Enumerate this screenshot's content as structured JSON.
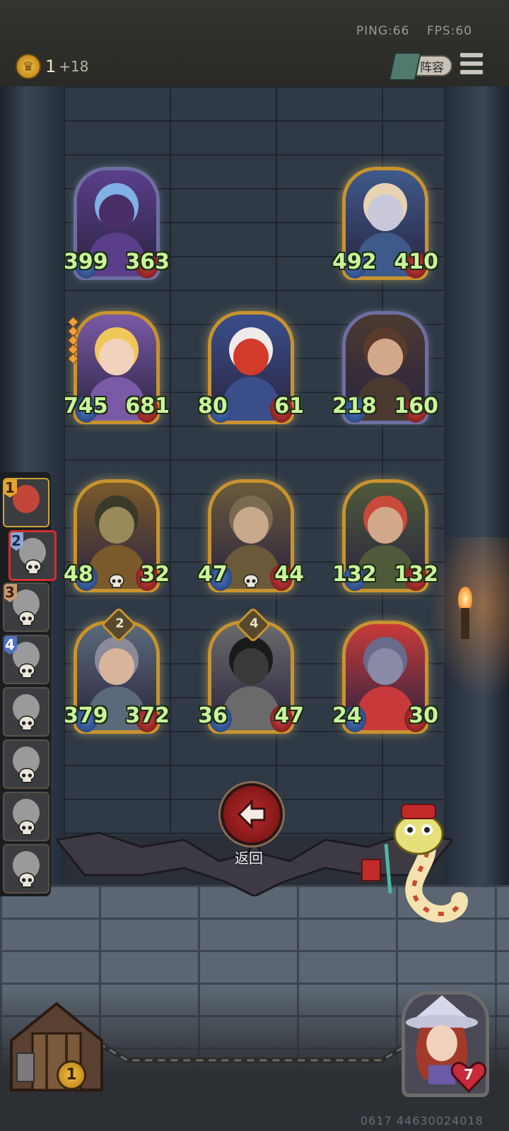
{
  "status_bar": {
    "ping": "PING:66",
    "fps": "FPS:60"
  },
  "currency": {
    "coins": "1",
    "income": "+18",
    "icon": "crown-coin-icon"
  },
  "toolbar": {
    "lineup_label": "阵容",
    "menu_icon": "hamburger-menu-icon"
  },
  "board": {
    "rows": [
      [
        {
          "name": "hero-blue-haired-mage",
          "atk": "399",
          "hp": "363",
          "frame": "silver",
          "pips": 0
        },
        null,
        {
          "name": "hero-bearded-king",
          "atk": "492",
          "hp": "410",
          "frame": "gold",
          "pips": 0
        }
      ],
      [
        {
          "name": "hero-blonde-boy",
          "atk": "745",
          "hp": "681",
          "frame": "gold",
          "pips": 5
        },
        {
          "name": "hero-clown",
          "atk": "80",
          "hp": "61",
          "frame": "gold",
          "pips": 0
        },
        {
          "name": "hero-mohawk-warrior",
          "atk": "218",
          "hp": "160",
          "frame": "silver",
          "pips": 0
        }
      ],
      [
        {
          "name": "hero-horned-goblin-lord",
          "atk": "48",
          "hp": "32",
          "frame": "gold",
          "skull": true
        },
        {
          "name": "hero-winged-beast",
          "atk": "47",
          "hp": "44",
          "frame": "gold",
          "skull": true
        },
        {
          "name": "hero-red-haired-ogre",
          "atk": "132",
          "hp": "132",
          "frame": "gold"
        }
      ],
      [
        {
          "name": "hero-armored-soldier",
          "atk": "379",
          "hp": "372",
          "frame": "gold",
          "tier": "2"
        },
        {
          "name": "hero-shield-knight",
          "atk": "36",
          "hp": "47",
          "frame": "gold",
          "tier": "4"
        },
        {
          "name": "hero-wolf-rogue",
          "atk": "24",
          "hp": "30",
          "frame": "gold"
        }
      ]
    ]
  },
  "opponents": [
    {
      "rank": "1",
      "state": "me"
    },
    {
      "rank": "2",
      "state": "current"
    },
    {
      "rank": "3",
      "state": "eliminated"
    },
    {
      "rank": "4",
      "state": "eliminated"
    },
    {
      "rank": "",
      "state": "eliminated"
    },
    {
      "rank": "",
      "state": "eliminated"
    },
    {
      "rank": "",
      "state": "eliminated"
    },
    {
      "rank": "",
      "state": "eliminated"
    }
  ],
  "back": {
    "label": "返回",
    "icon": "arrow-left-icon"
  },
  "tavern": {
    "level": "1"
  },
  "player": {
    "health": "7"
  },
  "build_id": "0617 44630024018",
  "colors": {
    "stat_text": "#c9f59a",
    "gold_frame": "#c8932e",
    "back_red": "#b82a2a"
  }
}
